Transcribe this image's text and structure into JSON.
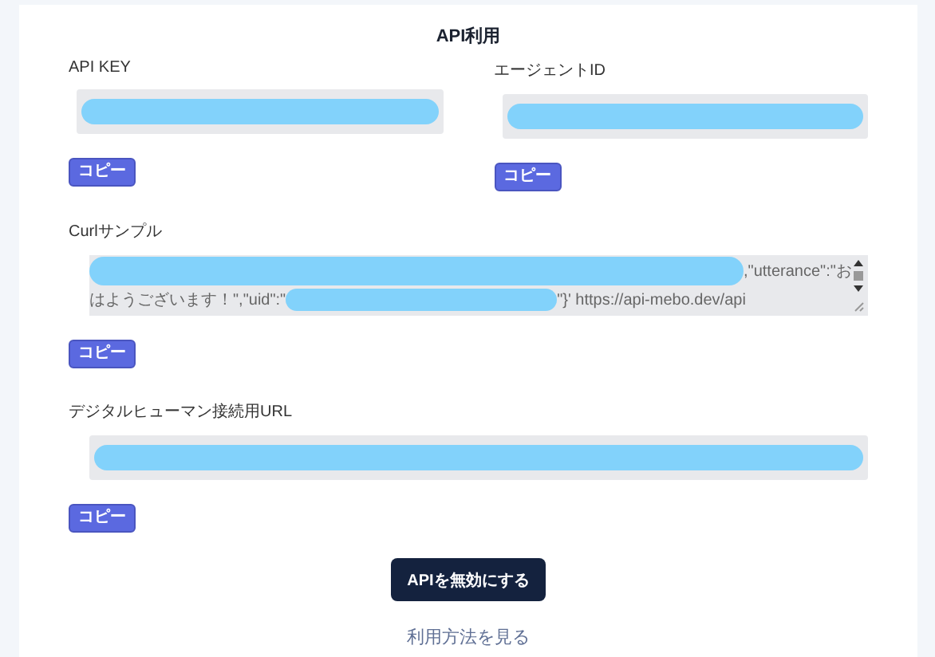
{
  "title": "API利用",
  "key_fields": [
    {
      "label": "API KEY",
      "copy_button": "コピー"
    },
    {
      "label": "エージェントID",
      "copy_button": "コピー"
    }
  ],
  "curl_sample": {
    "label": "Curlサンプル",
    "line_1_text": ",\"utterance\":\"お",
    "line_2_start": "はようございます！\",\"uid\":\"",
    "line_2_end": "\"}' https://api-mebo.dev/api",
    "copy_button": "コピー"
  },
  "connection_url": {
    "label": "デジタルヒューマン接続用URL",
    "copy_button": "コピー"
  },
  "disable_button": "APIを無効にする",
  "usage_link": "利用方法を見る"
}
